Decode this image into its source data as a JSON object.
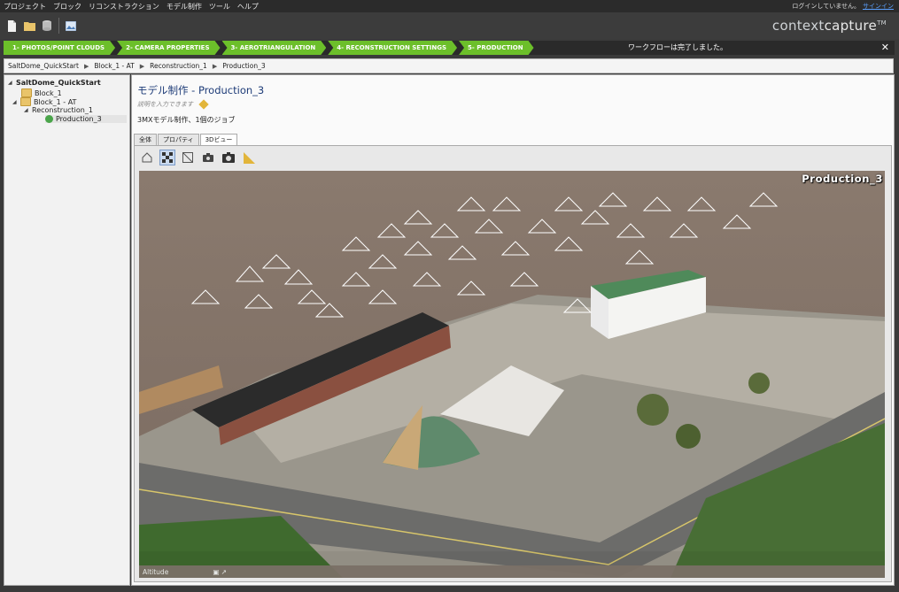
{
  "menu": {
    "items": [
      "プロジェクト",
      "ブロック",
      "リコンストラクション",
      "モデル制作",
      "ツール",
      "ヘルプ"
    ],
    "login_text": "ログインしていません。",
    "login_link": "サインイン"
  },
  "toolbar": {
    "icons": [
      "new-file-icon",
      "open-folder-icon",
      "database-icon",
      "image-icon"
    ]
  },
  "brand": {
    "prefix": "context",
    "suffix": "capture",
    "tm": "TM"
  },
  "workflow": {
    "steps": [
      "1- PHOTOS/POINT CLOUDS",
      "2- CAMERA PROPERTIES",
      "3- AEROTRIANGULATION",
      "4- RECONSTRUCTION SETTINGS",
      "5- PRODUCTION"
    ],
    "message": "ワークフローは完了しました。",
    "close": "✕"
  },
  "breadcrumb": [
    "SaltDome_QuickStart",
    "Block_1 - AT",
    "Reconstruction_1",
    "Production_3"
  ],
  "tree": {
    "root": "SaltDome_QuickStart",
    "block1": "Block_1",
    "block1at": "Block_1 - AT",
    "recon": "Reconstruction_1",
    "prod": "Production_3"
  },
  "production": {
    "title": "モデル制作 - Production_3",
    "description_placeholder": "説明を入力できます",
    "subtitle": "3MXモデル制作、1個のジョブ"
  },
  "tabs": [
    "全体",
    "プロパティ",
    "3Dビュー"
  ],
  "viewer": {
    "label": "Production_3",
    "footer_left": "Altitude",
    "footer_right": "▣ ↗"
  },
  "colors": {
    "accent_green": "#6cbf2a",
    "title_blue": "#1e3c78"
  }
}
